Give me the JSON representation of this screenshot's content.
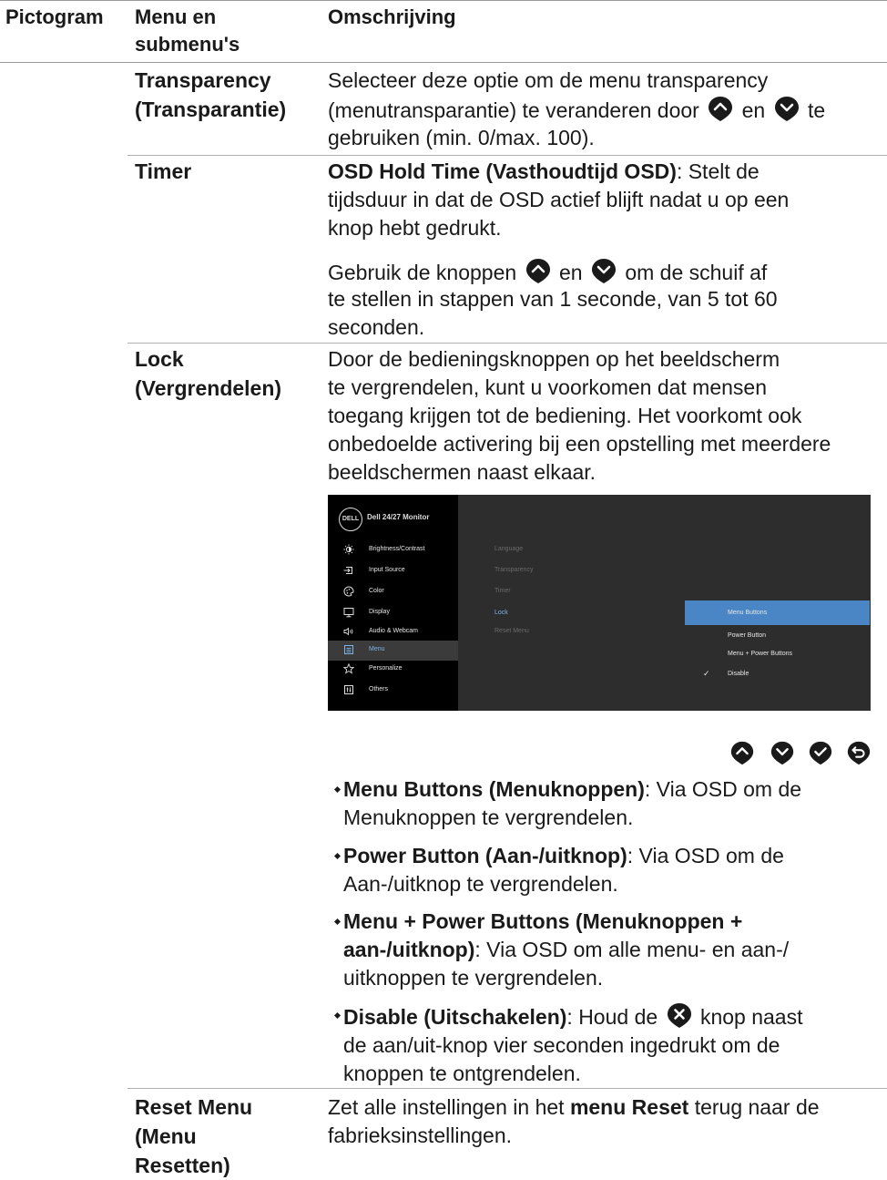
{
  "header": {
    "col1": "Pictogram",
    "col2_line1": "Menu en",
    "col2_line2": "submenu's",
    "col3": "Omschrijving"
  },
  "rows": {
    "transparency": {
      "name_line1": "Transparency",
      "name_line2": "(Transparantie)",
      "desc_line1": "Selecteer deze optie om de menu transparency",
      "desc_line2a": "(menutransparantie) te veranderen door",
      "desc_line2b": "en",
      "desc_line2c": "te",
      "desc_line3": "gebruiken (min. 0/max. 100)."
    },
    "timer": {
      "name": "Timer",
      "p1_bold": "OSD Hold Time (Vasthoudtijd OSD)",
      "p1_line1_rest": ": Stelt de",
      "p1_line2": "tijdsduur in dat de OSD actief blijft nadat u op een",
      "p1_line3": "knop hebt gedrukt.",
      "p2_a": "Gebruik de knoppen",
      "p2_b": "en",
      "p2_c": "om de schuif af",
      "p2_line2": "te stellen in stappen van 1 seconde, van 5 tot 60",
      "p2_line3": "seconden."
    },
    "lock": {
      "name_line1": "Lock",
      "name_line2": "(Vergrendelen)",
      "desc_line1": "Door de bedieningsknoppen op het beeldscherm",
      "desc_line2": "te vergrendelen, kunt u voorkomen dat mensen",
      "desc_line3": "toegang krijgen tot de bediening. Het voorkomt ook",
      "desc_line4": "onbedoelde activering bij een opstelling met meerdere",
      "desc_line5": "beeldschermen naast elkaar.",
      "bullets": [
        {
          "bold": "Menu Buttons (Menuknoppen)",
          "rest1": ": Via OSD om de",
          "line2": "Menuknoppen te vergrendelen."
        },
        {
          "bold": "Power Button (Aan-/uitknop)",
          "rest1": ": Via OSD om de",
          "line2": "Aan-/uitknop te vergrendelen."
        },
        {
          "bold1": "Menu + Power Buttons (Menuknoppen +",
          "bold2": "aan-/uitknop)",
          "rest2": ": Via OSD om alle menu- en aan-/",
          "line3": "uitknoppen te vergrendelen."
        },
        {
          "bold": "Disable (Uitschakelen)",
          "rest1a": ": Houd de",
          "rest1b": "knop naast",
          "line2": "de aan/uit-knop vier seconden ingedrukt om de",
          "line3": "knoppen te ontgrendelen."
        }
      ]
    },
    "reset": {
      "name_line1": "Reset Menu",
      "name_line2": "(Menu",
      "name_line3": "Resetten)",
      "desc_a": "Zet alle instellingen in het ",
      "desc_bold": "menu Reset",
      "desc_b": " terug naar de",
      "desc_line2": "fabrieksinstellingen."
    }
  },
  "osd": {
    "logo": "DELL",
    "model": "Dell 24/27 Monitor",
    "menu_items": [
      {
        "label": "Brightness/Contrast",
        "icon": "brightness-icon"
      },
      {
        "label": "Input Source",
        "icon": "input-source-icon"
      },
      {
        "label": "Color",
        "icon": "color-icon"
      },
      {
        "label": "Display",
        "icon": "display-icon"
      },
      {
        "label": "Audio & Webcam",
        "icon": "audio-icon"
      },
      {
        "label": "Menu",
        "icon": "menu-icon"
      },
      {
        "label": "Personalize",
        "icon": "star-icon"
      },
      {
        "label": "Others",
        "icon": "others-icon"
      }
    ],
    "submenu": [
      "Language",
      "Transparency",
      "Timer",
      "Lock",
      "Reset Menu"
    ],
    "options": [
      "Menu Buttons",
      "Power Button",
      "Menu + Power Buttons",
      "Disable"
    ],
    "check": "✓",
    "colors": {
      "highlight": "#4a86c5",
      "active_text": "#7fb2e5",
      "panel": "#2d2d2d",
      "sidebar": "#000000"
    }
  },
  "buttons": [
    "up-button-icon",
    "down-button-icon",
    "ok-button-icon",
    "back-button-icon"
  ]
}
